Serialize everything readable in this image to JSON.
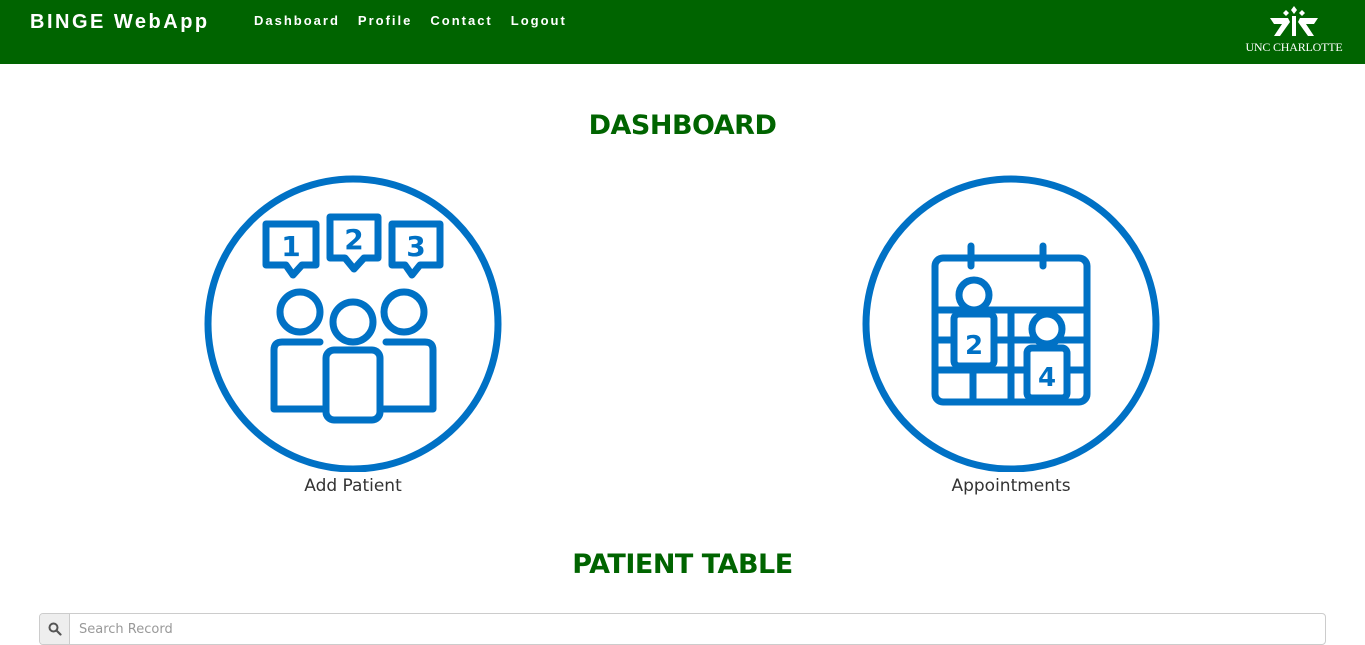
{
  "navbar": {
    "brand": "BINGE WebApp",
    "links": [
      "Dashboard",
      "Profile",
      "Contact",
      "Logout"
    ],
    "logo_text": "UNC CHARLOTTE",
    "background": "#006400"
  },
  "dashboard": {
    "title": "DASHBOARD",
    "tiles": [
      {
        "label": "Add Patient",
        "icon": "add-patient-group-icon",
        "badges": [
          "1",
          "2",
          "3"
        ]
      },
      {
        "label": "Appointments",
        "icon": "appointments-calendar-icon",
        "badges": [
          "2",
          "4"
        ]
      }
    ],
    "icon_color": "#0071c5"
  },
  "patient_table": {
    "title": "PATIENT TABLE",
    "search_placeholder": "Search Record",
    "search_icon": "search-icon"
  }
}
